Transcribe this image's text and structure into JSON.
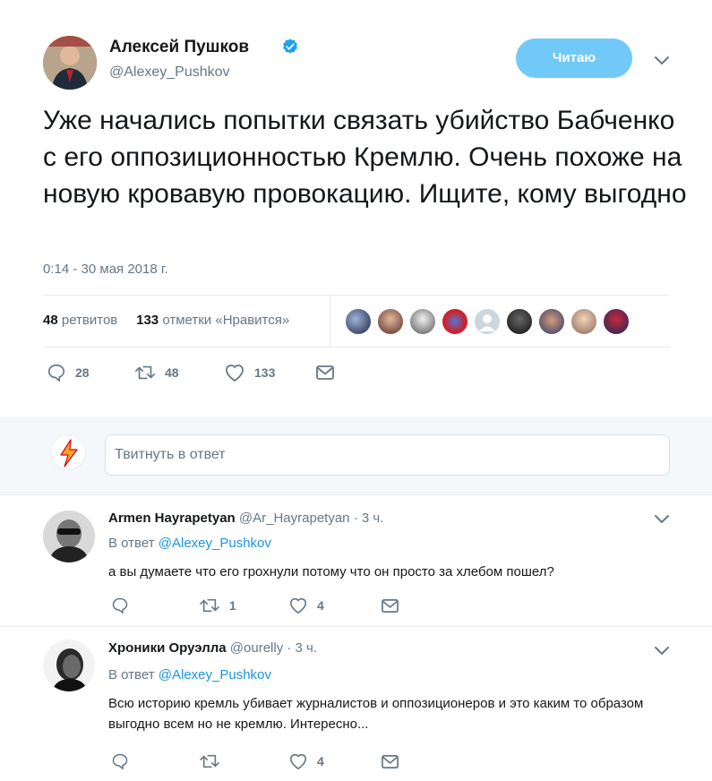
{
  "tweet": {
    "author_name": "Алексей Пушков",
    "author_handle": "@Alexey_Pushkov",
    "follow_label": "Читаю",
    "text": "Уже начались попытки связать убийство Бабченко с его оппозиционностью Кремлю. Очень похоже на новую кровавую провокацию. Ищите, кому выгодно",
    "timestamp": "0:14 - 30 мая 2018 г.",
    "retweets_count": "48",
    "retweets_label": "ретвитов",
    "likes_count": "133",
    "likes_label": "отметки «Нравится»",
    "actions": {
      "replies": "28",
      "retweets": "48",
      "likes": "133"
    }
  },
  "reply_box": {
    "placeholder": "Твитнуть в ответ"
  },
  "replies": [
    {
      "name": "Armen Hayrapetyan",
      "handle": "@Ar_Hayrapetyan",
      "time": "· 3 ч.",
      "in_reply_label": "В ответ",
      "in_reply_to": "@Alexey_Pushkov",
      "text": "а вы думаете что его грохнули потому что он просто за хлебом пошел?",
      "retweets": "1",
      "likes": "4"
    },
    {
      "name": "Хроники Оруэлла",
      "handle": "@ourelly",
      "time": "· 3 ч.",
      "in_reply_label": "В ответ",
      "in_reply_to": "@Alexey_Pushkov",
      "text": "Всю историю кремль убивает журналистов и оппозиционеров и это каким то образом выгодно всем но не кремлю. Интересно...",
      "retweets": "",
      "likes": "4"
    }
  ],
  "colors": {
    "accent": "#1da1f2",
    "follow_button": "#71c9f8",
    "muted": "#657786",
    "link": "#1b95e0"
  }
}
